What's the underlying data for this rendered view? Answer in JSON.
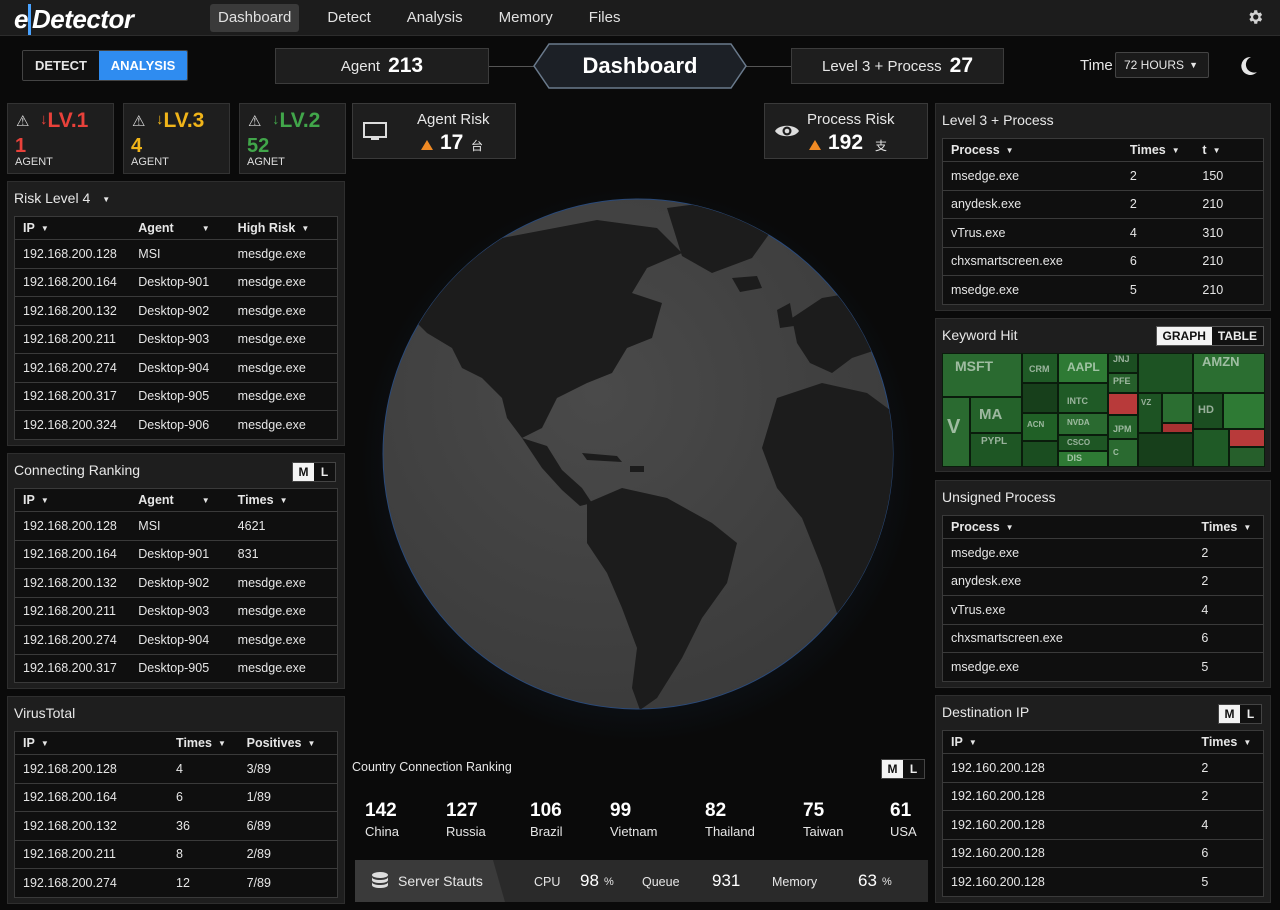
{
  "app": {
    "logo": "eDetector",
    "nav": [
      "Dashboard",
      "Detect",
      "Analysis",
      "Memory",
      "Files"
    ],
    "active_nav": "Dashboard"
  },
  "mode_toggle": {
    "detect": "DETECT",
    "analysis": "ANALYSIS",
    "active": "ANALYSIS"
  },
  "header": {
    "agent_label": "Agent",
    "agent_value": "213",
    "title": "Dashboard",
    "level3_label": "Level 3 + Process",
    "level3_value": "27",
    "time_label": "Time",
    "time_value": "72 HOURS"
  },
  "levels": [
    {
      "arrow": "↓",
      "level": "LV.1",
      "count": "1",
      "label": "AGENT",
      "color": "#e8413a"
    },
    {
      "arrow": "↓",
      "level": "LV.3",
      "count": "4",
      "label": "AGENT",
      "color": "#f0b419"
    },
    {
      "arrow": "↓",
      "level": "LV.2",
      "count": "52",
      "label": "AGNET",
      "color": "#41a64a"
    }
  ],
  "agent_risk": {
    "label": "Agent Risk",
    "value": "17",
    "unit": "台"
  },
  "process_risk": {
    "label": "Process Risk",
    "value": "192",
    "unit": "支"
  },
  "risk_level4": {
    "title": "Risk Level 4",
    "headers": [
      "IP",
      "Agent",
      "High Risk"
    ],
    "rows": [
      [
        "192.168.200.128",
        "MSI",
        "mesdge.exe"
      ],
      [
        "192.168.200.164",
        "Desktop-901",
        "mesdge.exe"
      ],
      [
        "192.168.200.132",
        "Desktop-902",
        "mesdge.exe"
      ],
      [
        "192.168.200.211",
        "Desktop-903",
        "mesdge.exe"
      ],
      [
        "192.168.200.274",
        "Desktop-904",
        "mesdge.exe"
      ],
      [
        "192.168.200.317",
        "Desktop-905",
        "mesdge.exe"
      ],
      [
        "192.168.200.324",
        "Desktop-906",
        "mesdge.exe"
      ]
    ]
  },
  "connecting_ranking": {
    "title": "Connecting Ranking",
    "m": "M",
    "l": "L",
    "headers": [
      "IP",
      "Agent",
      "Times"
    ],
    "rows": [
      [
        "192.168.200.128",
        "MSI",
        "4621"
      ],
      [
        "192.168.200.164",
        "Desktop-901",
        "831"
      ],
      [
        "192.168.200.132",
        "Desktop-902",
        "mesdge.exe"
      ],
      [
        "192.168.200.211",
        "Desktop-903",
        "mesdge.exe"
      ],
      [
        "192.168.200.274",
        "Desktop-904",
        "mesdge.exe"
      ],
      [
        "192.168.200.317",
        "Desktop-905",
        "mesdge.exe"
      ]
    ]
  },
  "virustotal": {
    "title": "VirusTotal",
    "headers": [
      "IP",
      "Times",
      "Positives"
    ],
    "rows": [
      [
        "192.168.200.128",
        "4",
        "3/89"
      ],
      [
        "192.168.200.164",
        "6",
        "1/89"
      ],
      [
        "192.168.200.132",
        "36",
        "6/89"
      ],
      [
        "192.168.200.211",
        "8",
        "2/89"
      ],
      [
        "192.168.200.274",
        "12",
        "7/89"
      ]
    ]
  },
  "level3_process": {
    "title": "Level 3 + Process",
    "headers": [
      "Process",
      "Times",
      "t"
    ],
    "rows": [
      [
        "msedge.exe",
        "2",
        "150"
      ],
      [
        "anydesk.exe",
        "2",
        "210"
      ],
      [
        "vTrus.exe",
        "4",
        "310"
      ],
      [
        "chxsmartscreen.exe",
        "6",
        "210"
      ],
      [
        "msedge.exe",
        "5",
        "210"
      ]
    ]
  },
  "keyword_hit": {
    "title": "Keyword Hit",
    "graph": "GRAPH",
    "table": "TABLE",
    "tiles": [
      "MSFT",
      "AAPL",
      "AMZN",
      "MA",
      "V",
      "PYPL",
      "CRM",
      "JNJ",
      "PFE",
      "HD",
      "JPM",
      "DIS",
      "INTC",
      "NVDA",
      "CSCO",
      "VZ",
      "ACN",
      "DHR",
      "C"
    ]
  },
  "unsigned_process": {
    "title": "Unsigned Process",
    "headers": [
      "Process",
      "Times"
    ],
    "rows": [
      [
        "msedge.exe",
        "2"
      ],
      [
        "anydesk.exe",
        "2"
      ],
      [
        "vTrus.exe",
        "4"
      ],
      [
        "chxsmartscreen.exe",
        "6"
      ],
      [
        "msedge.exe",
        "5"
      ]
    ]
  },
  "destination_ip": {
    "title": "Destination IP",
    "m": "M",
    "l": "L",
    "headers": [
      "IP",
      "Times"
    ],
    "rows": [
      [
        "192.160.200.128",
        "2"
      ],
      [
        "192.160.200.128",
        "2"
      ],
      [
        "192.160.200.128",
        "4"
      ],
      [
        "192.160.200.128",
        "6"
      ],
      [
        "192.160.200.128",
        "5"
      ]
    ]
  },
  "country_ranking": {
    "title": "Country Connection Ranking",
    "m": "M",
    "l": "L",
    "items": [
      {
        "value": "142",
        "country": "China"
      },
      {
        "value": "127",
        "country": "Russia"
      },
      {
        "value": "106",
        "country": "Brazil"
      },
      {
        "value": "99",
        "country": "Vietnam"
      },
      {
        "value": "82",
        "country": "Thailand"
      },
      {
        "value": "75",
        "country": "Taiwan"
      },
      {
        "value": "61",
        "country": "USA"
      }
    ]
  },
  "server_status": {
    "label": "Server Stauts",
    "cpu_label": "CPU",
    "cpu_value": "98",
    "pct": "%",
    "queue_label": "Queue",
    "queue_value": "931",
    "memory_label": "Memory",
    "memory_value": "63"
  },
  "colors": {
    "accent": "#2f8cf0",
    "red": "#e8413a",
    "yellow": "#f0b419",
    "green": "#41a64a",
    "orange": "#f08a24"
  }
}
